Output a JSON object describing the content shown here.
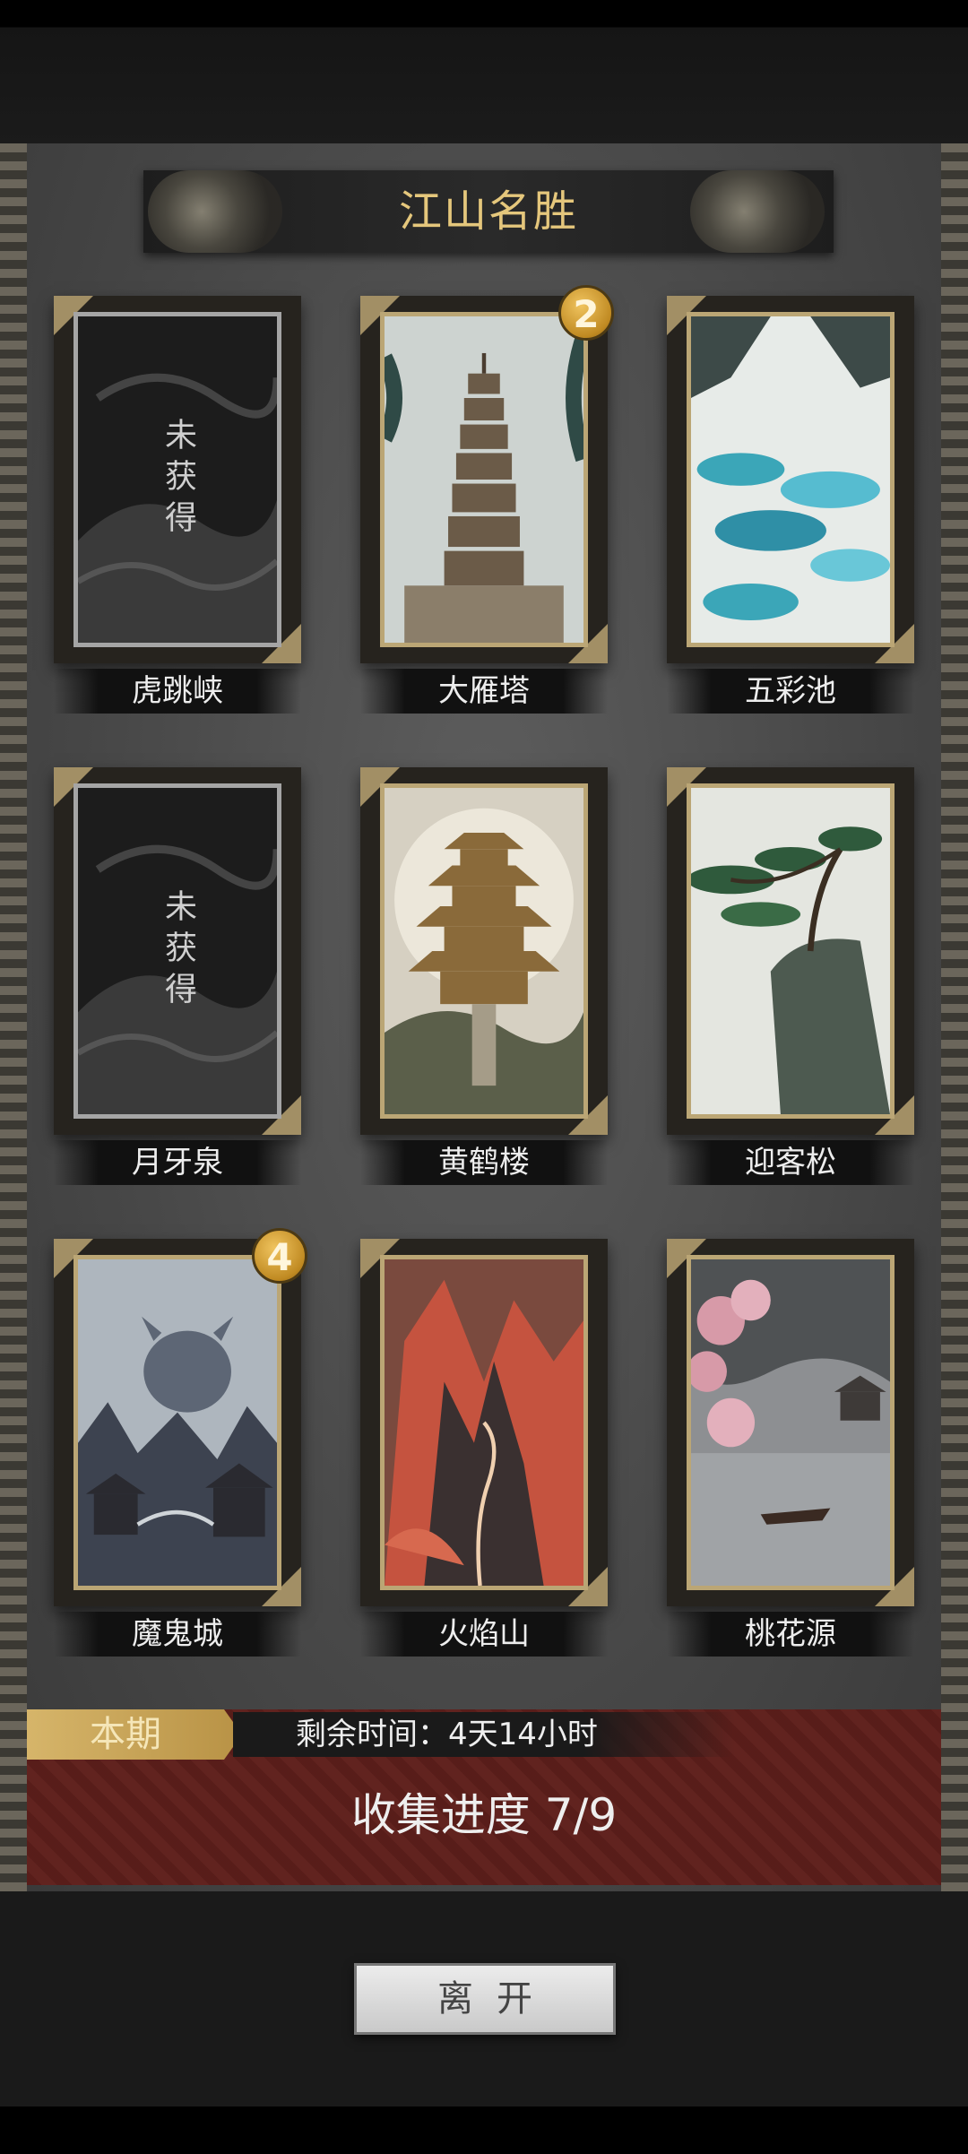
{
  "title": "江山名胜",
  "cards": [
    {
      "name": "虎跳峡",
      "locked": true,
      "locked_text": "未获得",
      "badge": null,
      "art_icon": "mist-icon"
    },
    {
      "name": "大雁塔",
      "locked": false,
      "badge": "2",
      "art_icon": "pagoda-icon"
    },
    {
      "name": "五彩池",
      "locked": false,
      "badge": null,
      "art_icon": "pools-icon"
    },
    {
      "name": "月牙泉",
      "locked": true,
      "locked_text": "未获得",
      "badge": null,
      "art_icon": "mist-icon"
    },
    {
      "name": "黄鹤楼",
      "locked": false,
      "badge": null,
      "art_icon": "tower-icon"
    },
    {
      "name": "迎客松",
      "locked": false,
      "badge": null,
      "art_icon": "pine-icon"
    },
    {
      "name": "魔鬼城",
      "locked": false,
      "badge": "4",
      "art_icon": "demon-city-icon"
    },
    {
      "name": "火焰山",
      "locked": false,
      "badge": null,
      "art_icon": "flame-mountain-icon"
    },
    {
      "name": "桃花源",
      "locked": false,
      "badge": null,
      "art_icon": "peach-blossom-icon"
    }
  ],
  "info": {
    "period_label": "本期",
    "time_remaining": "剩余时间：4天14小时",
    "progress": "收集进度  7/9"
  },
  "leave_button": "离开",
  "colors": {
    "gold": "#e5c77c",
    "frame": "#bba675",
    "red_panel": "#5e1f1b"
  }
}
